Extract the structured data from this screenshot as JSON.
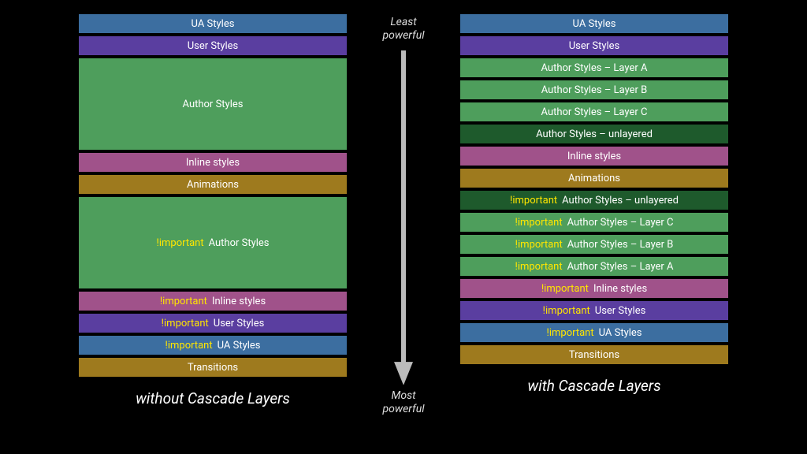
{
  "scale": {
    "top": "Least powerful",
    "bottom": "Most powerful"
  },
  "columns": {
    "left": {
      "caption": "without Cascade Layers",
      "layers": [
        {
          "label": "UA Styles",
          "color": "blue",
          "size": "sm",
          "important": false
        },
        {
          "label": "User Styles",
          "color": "purple",
          "size": "sm",
          "important": false
        },
        {
          "label": "Author Styles",
          "color": "green",
          "size": "big",
          "important": false
        },
        {
          "label": "Inline styles",
          "color": "magenta",
          "size": "sm",
          "important": false
        },
        {
          "label": "Animations",
          "color": "gold",
          "size": "sm",
          "important": false
        },
        {
          "label": "Author Styles",
          "color": "green",
          "size": "big",
          "important": true
        },
        {
          "label": "Inline styles",
          "color": "magenta",
          "size": "sm",
          "important": true
        },
        {
          "label": "User Styles",
          "color": "purple",
          "size": "sm",
          "important": true
        },
        {
          "label": "UA Styles",
          "color": "blue",
          "size": "sm",
          "important": true
        },
        {
          "label": "Transitions",
          "color": "gold",
          "size": "sm",
          "important": false
        }
      ]
    },
    "right": {
      "caption": "with Cascade Layers",
      "layers": [
        {
          "label": "UA Styles",
          "color": "blue",
          "size": "sm",
          "important": false
        },
        {
          "label": "User Styles",
          "color": "purple",
          "size": "sm",
          "important": false
        },
        {
          "label": "Author Styles – Layer A",
          "color": "green",
          "size": "sm",
          "important": false
        },
        {
          "label": "Author Styles – Layer B",
          "color": "green",
          "size": "sm",
          "important": false
        },
        {
          "label": "Author Styles – Layer C",
          "color": "green",
          "size": "sm",
          "important": false
        },
        {
          "label": "Author Styles – unlayered",
          "color": "dgreen",
          "size": "sm",
          "important": false
        },
        {
          "label": "Inline styles",
          "color": "magenta",
          "size": "sm",
          "important": false
        },
        {
          "label": "Animations",
          "color": "gold",
          "size": "sm",
          "important": false
        },
        {
          "label": "Author Styles – unlayered",
          "color": "dgreen",
          "size": "sm",
          "important": true
        },
        {
          "label": "Author Styles – Layer C",
          "color": "green",
          "size": "sm",
          "important": true
        },
        {
          "label": "Author Styles – Layer B",
          "color": "green",
          "size": "sm",
          "important": true
        },
        {
          "label": "Author Styles – Layer A",
          "color": "green",
          "size": "sm",
          "important": true
        },
        {
          "label": "Inline styles",
          "color": "magenta",
          "size": "sm",
          "important": true
        },
        {
          "label": "User Styles",
          "color": "purple",
          "size": "sm",
          "important": true
        },
        {
          "label": "UA Styles",
          "color": "blue",
          "size": "sm",
          "important": true
        },
        {
          "label": "Transitions",
          "color": "gold",
          "size": "sm",
          "important": false
        }
      ]
    }
  },
  "important_marker": "!important"
}
